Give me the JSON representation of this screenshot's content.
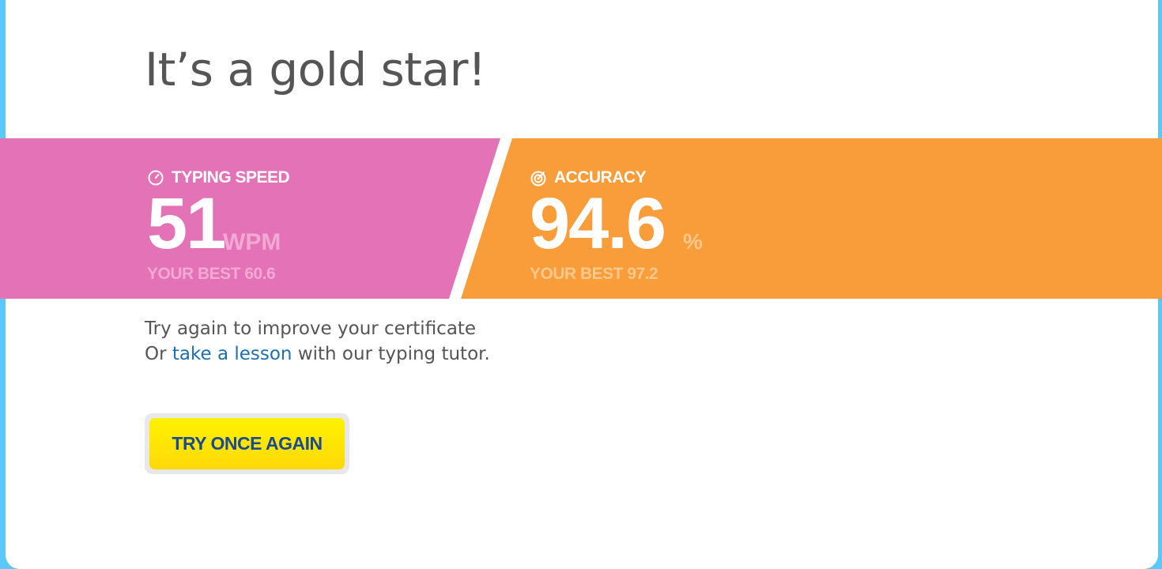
{
  "page": {
    "title": "It’s a gold star!"
  },
  "stats": {
    "speed": {
      "label": "TYPING SPEED",
      "icon": "speedometer-icon",
      "value": "51",
      "unit": "WPM",
      "best": "YOUR BEST 60.6",
      "color": "#e372b6"
    },
    "accuracy": {
      "label": "ACCURACY",
      "icon": "target-icon",
      "value": "94.6",
      "unit": "%",
      "best": "YOUR BEST 97.2",
      "color": "#f89d39"
    }
  },
  "message": {
    "line1": "Try again to improve your certificate",
    "line2_prefix": "Or ",
    "line2_link": "take a lesson",
    "line2_suffix": " with our typing tutor."
  },
  "actions": {
    "try_again_label": "TRY ONCE AGAIN"
  },
  "colors": {
    "background": "#5ac8fa",
    "link": "#1f6fb0",
    "button": "#fff200",
    "button_text": "#1a4b8f"
  }
}
